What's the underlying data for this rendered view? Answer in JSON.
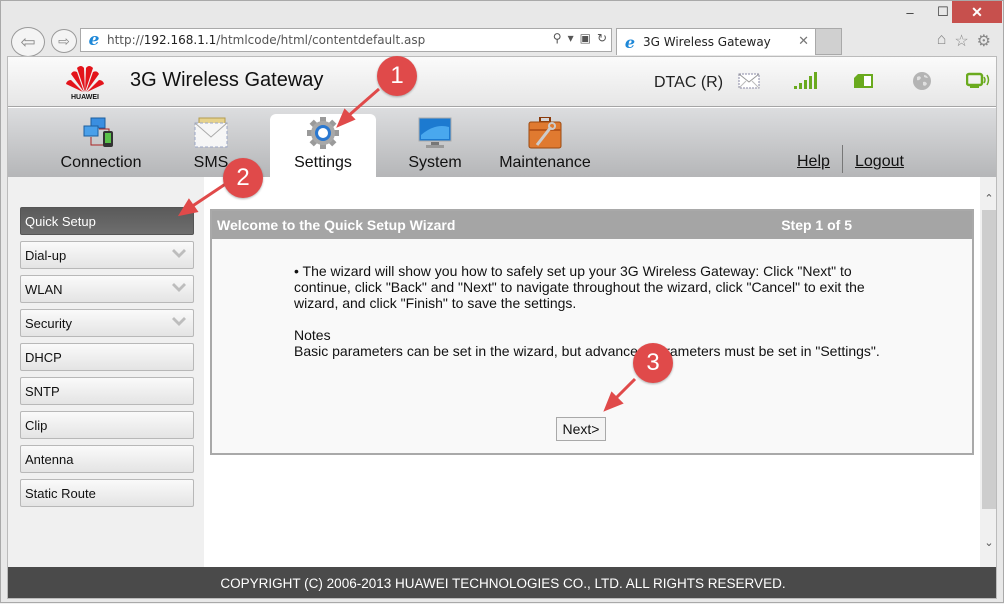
{
  "browser": {
    "window_controls": {
      "minimize": "–",
      "maximize": "☐",
      "close": "✕"
    },
    "address_prefix": "http://",
    "address_host": "192.168.1.1",
    "address_path": "/htmlcode/html/contentdefault.asp",
    "address_tools": {
      "search": "⚲",
      "dropdown": "▾",
      "compat": "▣",
      "refresh": "↻"
    },
    "tab_title": "3G Wireless Gateway",
    "tab_close": "✕",
    "toolbar_icons": {
      "home": "⌂",
      "favorites": "☆",
      "settings": "⚙"
    }
  },
  "header": {
    "logo_text": "HUAWEI",
    "title": "3G Wireless Gateway",
    "operator": "DTAC (R)"
  },
  "nav": {
    "items": [
      {
        "label": "Connection",
        "icon": "connection-icon"
      },
      {
        "label": "SMS",
        "icon": "sms-icon"
      },
      {
        "label": "Settings",
        "icon": "settings-icon",
        "active": true
      },
      {
        "label": "System",
        "icon": "system-icon"
      },
      {
        "label": "Maintenance",
        "icon": "maintenance-icon"
      }
    ],
    "help": "Help",
    "logout": "Logout"
  },
  "sidebar": {
    "items": [
      {
        "label": "Quick Setup",
        "active": true
      },
      {
        "label": "Dial-up",
        "expandable": true
      },
      {
        "label": "WLAN",
        "expandable": true
      },
      {
        "label": "Security",
        "expandable": true
      },
      {
        "label": "DHCP"
      },
      {
        "label": "SNTP"
      },
      {
        "label": "Clip"
      },
      {
        "label": "Antenna"
      },
      {
        "label": "Static Route"
      }
    ]
  },
  "wizard": {
    "title": "Welcome to the Quick Setup Wizard",
    "step": "Step 1 of 5",
    "intro": "•   The wizard will show you how to safely set up your 3G Wireless Gateway: Click \"Next\" to continue, click \"Back\" and \"Next\" to navigate throughout the wizard, click \"Cancel\" to exit the wizard, and click \"Finish\" to save the settings.",
    "notes_label": "Notes",
    "notes_text": "Basic parameters can be set in the wizard, but advanced parameters must be set in \"Settings\".",
    "next_button": "Next>"
  },
  "scrollbar": {
    "up": "⌃",
    "down": "⌄"
  },
  "footer": {
    "copyright": "COPYRIGHT (C) 2006-2013 HUAWEI TECHNOLOGIES CO., LTD. ALL RIGHTS RESERVED."
  },
  "callouts": [
    "1",
    "2",
    "3"
  ],
  "colors": {
    "callout": "#e04a4a",
    "footer_bg": "#4a4a4a",
    "panel_header": "#a5a5a5",
    "status_green": "#6aaa1e"
  }
}
